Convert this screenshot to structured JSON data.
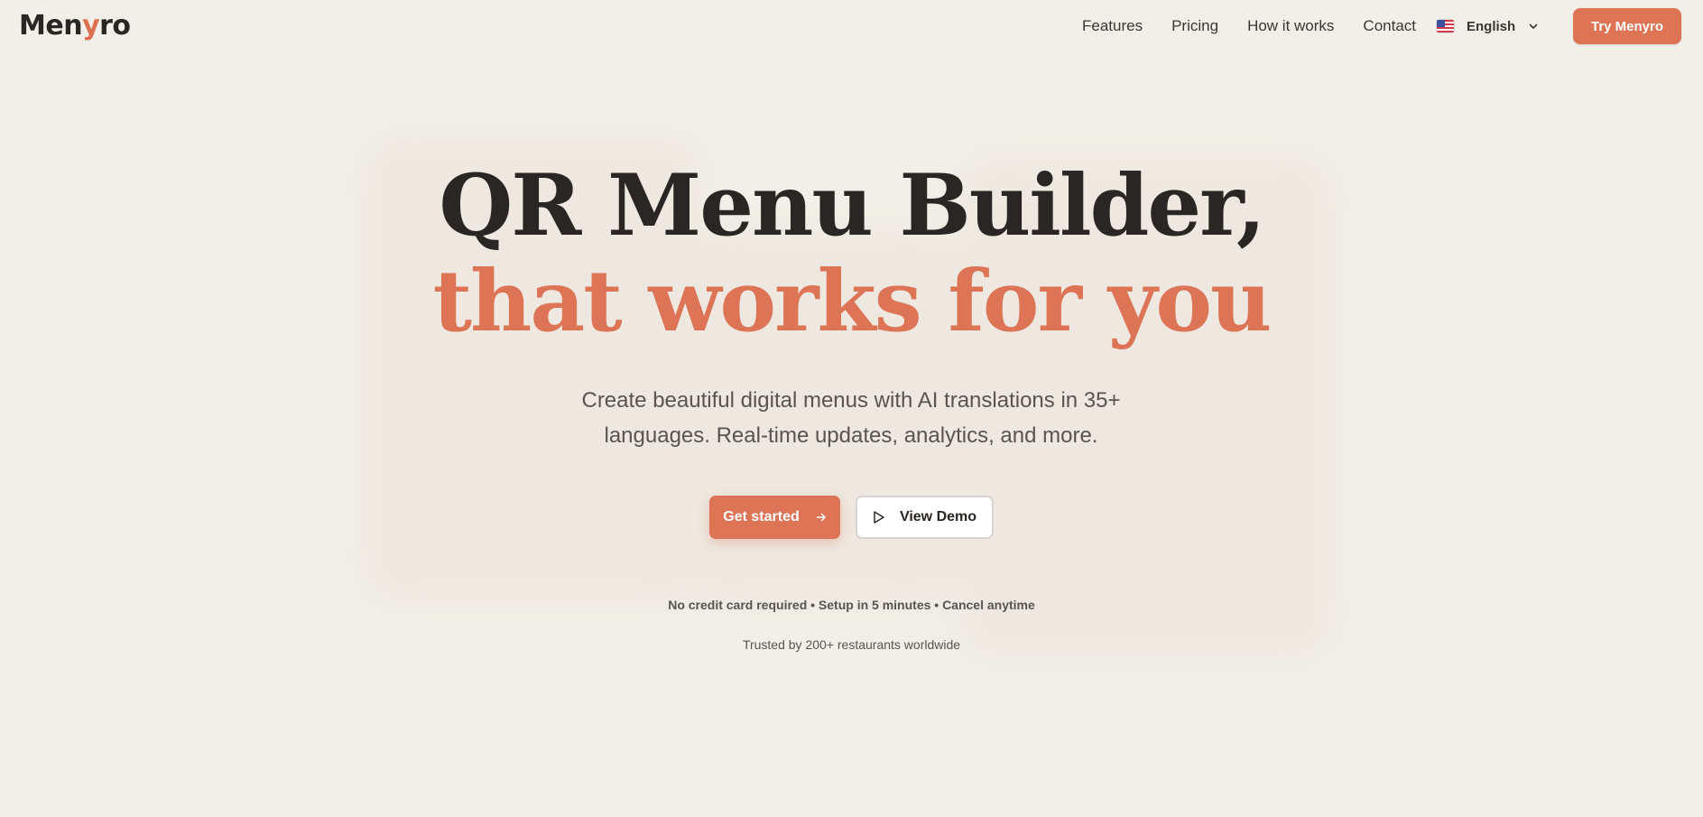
{
  "header": {
    "logo_prefix": "Men",
    "logo_accent": "y",
    "logo_suffix": "ro",
    "nav": [
      {
        "label": "Features"
      },
      {
        "label": "Pricing"
      },
      {
        "label": "How it works"
      },
      {
        "label": "Contact"
      }
    ],
    "language": {
      "flag_icon": "us-flag-icon",
      "label": "English",
      "chevron_icon": "chevron-down-icon"
    },
    "cta_label": "Try Menyro"
  },
  "hero": {
    "title_line1": "QR Menu Builder,",
    "title_line2": "that works for you",
    "subtitle": "Create beautiful digital menus with AI translations in 35+ languages. Real-time updates, analytics, and more.",
    "primary_button": "Get started",
    "primary_icon": "arrow-right-icon",
    "secondary_button": "View Demo",
    "secondary_icon": "play-icon",
    "note": "No credit card required • Setup in 5 minutes • Cancel anytime",
    "trusted": "Trusted by 200+ restaurants worldwide"
  },
  "colors": {
    "background": "#f2efe8",
    "accent": "#dc7455",
    "text": "#2a2623",
    "muted": "#5a5450"
  }
}
